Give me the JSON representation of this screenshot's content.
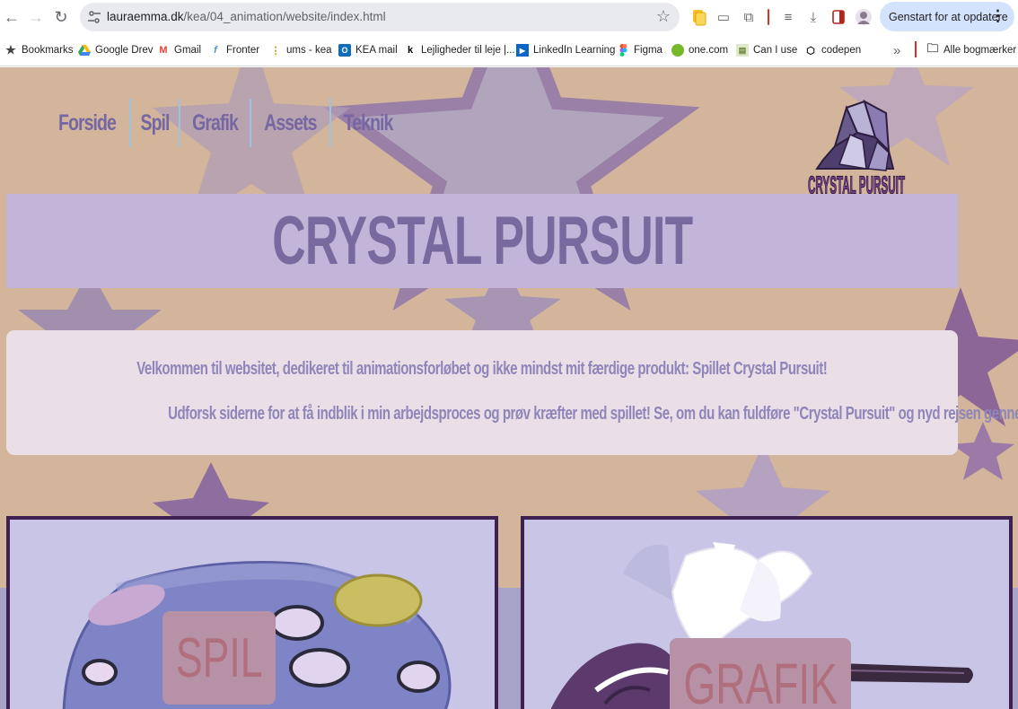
{
  "browser": {
    "url_host": "lauraemma.dk",
    "url_path": "/kea/04_animation/website/index.html",
    "update_button": "Genstart for at opdatere",
    "bookmarks": [
      {
        "label": "Bookmarks",
        "icon": "star-icon"
      },
      {
        "label": "Google Drev",
        "icon": "google-drive-icon"
      },
      {
        "label": "Gmail",
        "icon": "gmail-icon"
      },
      {
        "label": "Fronter",
        "icon": "fronter-icon"
      },
      {
        "label": "ums - kea",
        "icon": "dots-icon"
      },
      {
        "label": "KEA mail",
        "icon": "outlook-icon"
      },
      {
        "label": "Lejligheder til leje |...",
        "icon": "k-icon"
      },
      {
        "label": "LinkedIn Learning",
        "icon": "linkedin-learning-icon"
      },
      {
        "label": "Figma",
        "icon": "figma-icon"
      },
      {
        "label": "one.com",
        "icon": "onecom-icon"
      },
      {
        "label": "Can I use",
        "icon": "caniuse-icon"
      },
      {
        "label": "codepen",
        "icon": "codepen-icon"
      }
    ],
    "all_bookmarks": "Alle bogmærker",
    "colors": {
      "update_bg": "#d3e3fd",
      "omnibox_bg": "#e8eaed"
    }
  },
  "site": {
    "nav": [
      "Forside",
      "Spil",
      "Grafik",
      "Assets",
      "Teknik"
    ],
    "logo_text": "CRYSTAL PURSUIT",
    "title": "CRYSTAL PURSUIT",
    "welcome_line1": "Velkommen til websitet, dedikeret til animationsforløbet og ikke mindst mit færdige produkt: Spillet Crystal Pursuit!",
    "welcome_line2": "Udforsk siderne for at få indblik i min arbejdsproces og prøv kræfter med spillet! Se, om du kan fuldføre \"Crystal Pursuit\" og nyd rejsen gennem krystalverdenen!",
    "cards": [
      {
        "label": "SPIL",
        "icon": "game-controller-icon"
      },
      {
        "label": "GRAFIK",
        "icon": "unicorn-illustration"
      }
    ],
    "colors": {
      "background": "#d2b59a",
      "title_bar": "#c3b4da",
      "title_text": "#786a9f",
      "nav_text": "#7567a3",
      "welcome_bg": "#eadfe7",
      "welcome_text": "#8e86b9",
      "card_border": "#3d2150",
      "card_bg": "#c8c5e6",
      "card_label_bg": "#b791a6",
      "card_label_text": "#b16e7d"
    }
  }
}
